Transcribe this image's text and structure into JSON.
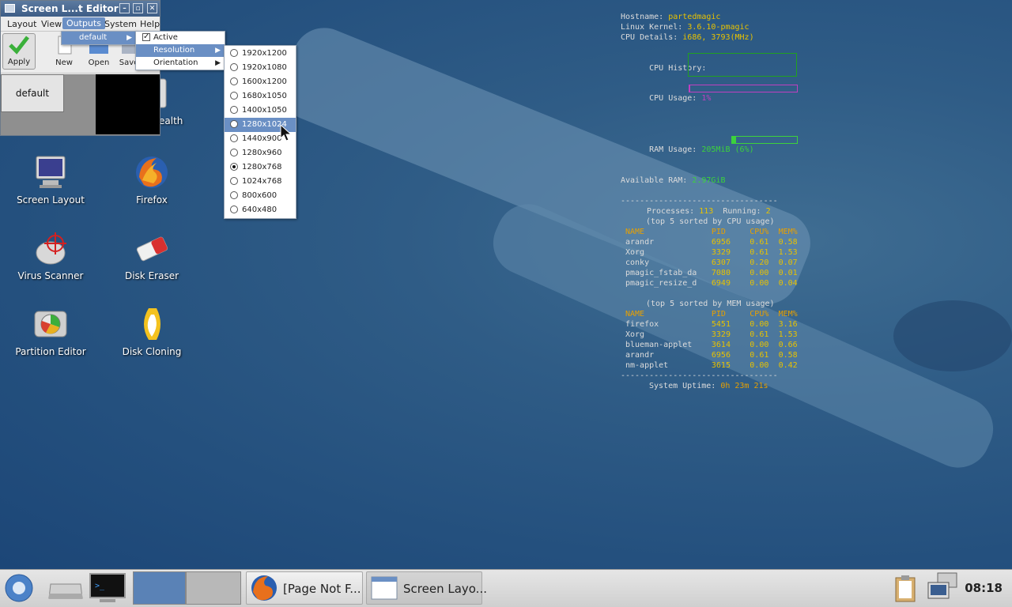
{
  "desktop": {
    "icons": [
      {
        "label": "Screen Layout",
        "icon": "monitor-icon"
      },
      {
        "label": "Firefox",
        "icon": "firefox-icon"
      },
      {
        "label": "Virus Scanner",
        "icon": "virus-scanner-icon"
      },
      {
        "label": "Disk Eraser",
        "icon": "eraser-icon"
      },
      {
        "label": "Partition Editor",
        "icon": "partition-editor-icon"
      },
      {
        "label": "Disk Cloning",
        "icon": "disk-cloning-icon"
      },
      {
        "label": "ealth",
        "icon": "health-icon"
      }
    ]
  },
  "window": {
    "title": "Screen L...t Editor",
    "menubar": [
      "Layout",
      "View",
      "Outputs",
      "System",
      "Help"
    ],
    "toolbar": [
      "Apply",
      "New",
      "Open",
      "Save"
    ],
    "screen_label": "default"
  },
  "outputs_menu": {
    "item": "default"
  },
  "default_submenu": {
    "active_label": "Active",
    "resolution_label": "Resolution",
    "orientation_label": "Orientation"
  },
  "resolutions": {
    "options": [
      "1920x1200",
      "1920x1080",
      "1600x1200",
      "1680x1050",
      "1400x1050",
      "1280x1024",
      "1440x900",
      "1280x960",
      "1280x768",
      "1024x768",
      "800x600",
      "640x480"
    ],
    "selected": "1280x768",
    "highlighted": "1280x1024"
  },
  "conky": {
    "hostname_label": "Hostname:",
    "hostname": "partedmagic",
    "kernel_label": "Linux Kernel:",
    "kernel": "3.6.10-pmagic",
    "cpu_label": "CPU Details:",
    "cpu": "i686, 3793(MHz)",
    "cpu_history_label": "CPU History:",
    "cpu_usage_label": "CPU Usage:",
    "cpu_usage": "1%",
    "ram_usage_label": "RAM Usage:",
    "ram_usage": "205MiB (6%)",
    "available_ram_label": "Available RAM:",
    "available_ram": "2.97GiB",
    "separator": "---------------------------------",
    "processes_label": "Processes:",
    "processes": "113",
    "running_label": "Running:",
    "running": "2",
    "cpu_table_title": "(top 5 sorted by CPU usage)",
    "mem_table_title": "(top 5 sorted by MEM usage)",
    "columns": [
      "NAME",
      "PID",
      "CPU%",
      "MEM%"
    ],
    "cpu_rows": [
      [
        "arandr",
        "6956",
        "0.61",
        "0.58"
      ],
      [
        "Xorg",
        "3329",
        "0.61",
        "1.53"
      ],
      [
        "conky",
        "6307",
        "0.20",
        "0.07"
      ],
      [
        "pmagic_fstab_da",
        "7080",
        "0.00",
        "0.01"
      ],
      [
        "pmagic_resize_d",
        "6949",
        "0.00",
        "0.04"
      ]
    ],
    "mem_rows": [
      [
        "firefox",
        "5451",
        "0.00",
        "3.16"
      ],
      [
        "Xorg",
        "3329",
        "0.61",
        "1.53"
      ],
      [
        "blueman-applet",
        "3614",
        "0.00",
        "0.66"
      ],
      [
        "arandr",
        "6956",
        "0.61",
        "0.58"
      ],
      [
        "nm-applet",
        "3615",
        "0.00",
        "0.42"
      ]
    ],
    "uptime_label": "System Uptime:",
    "uptime": "0h 23m 21s",
    "cpu_usage_fraction": 0.01,
    "ram_usage_fraction": 0.06
  },
  "taskbar": {
    "tasks": [
      {
        "label": "[Page Not F...",
        "icon": "firefox-icon"
      },
      {
        "label": "Screen Layo...",
        "icon": "window-icon"
      }
    ],
    "clock": "08:18"
  },
  "colors": {
    "desktop": "#24507e",
    "highlight": "#6a8fc4",
    "conky_value": "#e8c200",
    "conky_green": "#3cd23c",
    "cpu_bar": "#c040c0"
  }
}
